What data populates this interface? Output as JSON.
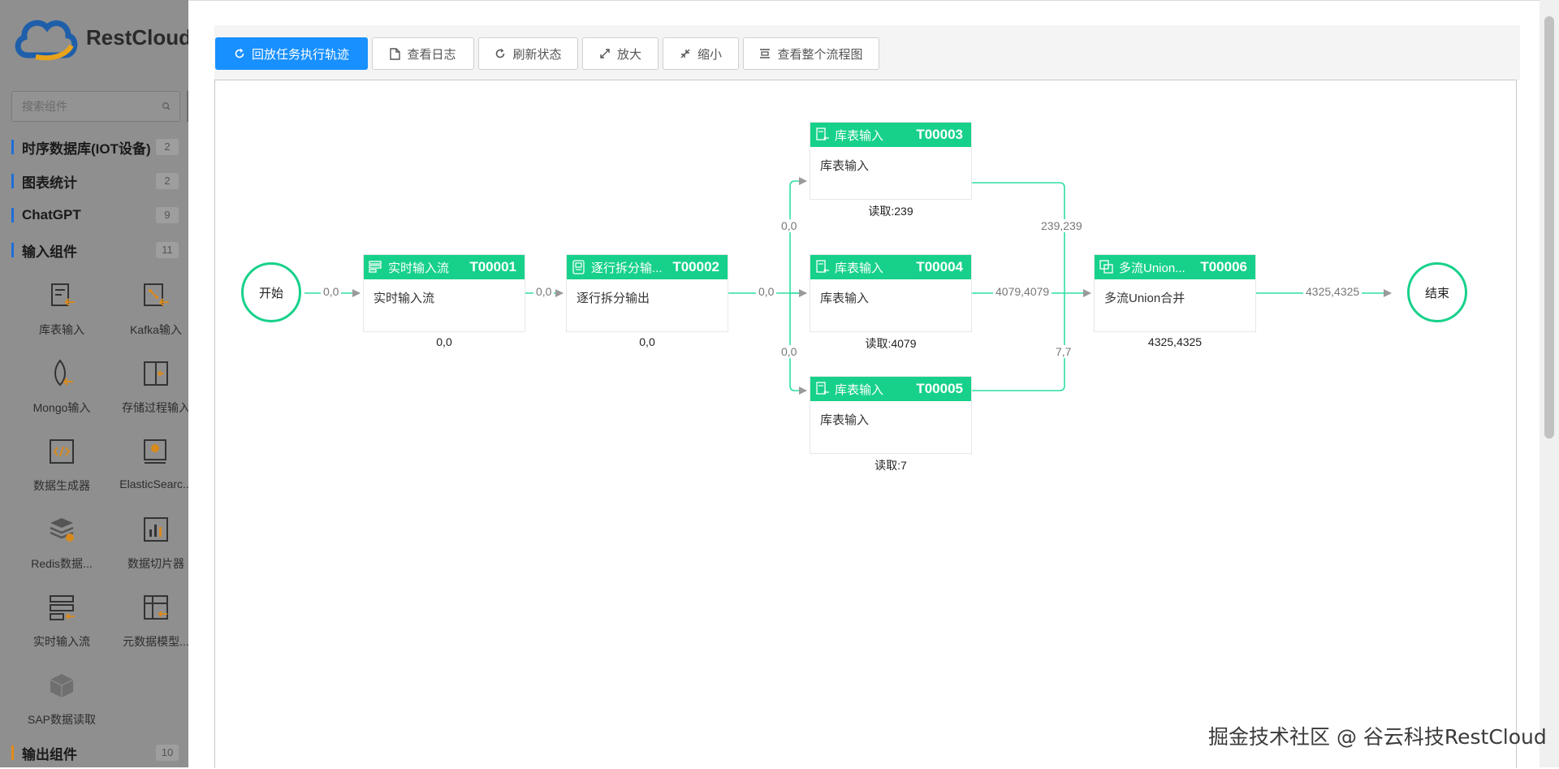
{
  "sidebar": {
    "logo_text": "RestCloud",
    "search_placeholder": "搜索组件",
    "categories": [
      {
        "label": "时序数据库(IOT设备)",
        "count": "2"
      },
      {
        "label": "图表统计",
        "count": "2"
      },
      {
        "label": "ChatGPT",
        "count": "9"
      },
      {
        "label": "输入组件",
        "count": "11"
      },
      {
        "label": "输出组件",
        "count": "10"
      }
    ],
    "components": [
      {
        "label": "库表输入",
        "icon": "table-input-icon"
      },
      {
        "label": "Kafka输入",
        "icon": "kafka-input-icon"
      },
      {
        "label": "Mongo输入",
        "icon": "mongo-input-icon"
      },
      {
        "label": "存储过程输入",
        "icon": "stored-procedure-icon"
      },
      {
        "label": "数据生成器",
        "icon": "code-generator-icon"
      },
      {
        "label": "ElasticSearc...",
        "icon": "elasticsearch-icon"
      },
      {
        "label": "Redis数据...",
        "icon": "redis-icon"
      },
      {
        "label": "数据切片器",
        "icon": "chart-slicer-icon"
      },
      {
        "label": "实时输入流",
        "icon": "stream-input-icon"
      },
      {
        "label": "元数据模型...",
        "icon": "metadata-model-icon"
      },
      {
        "label": "SAP数据读取",
        "icon": "sap-cube-icon"
      }
    ]
  },
  "toolbar": {
    "replay": "回放任务执行轨迹",
    "logs": "查看日志",
    "refresh": "刷新状态",
    "zoom_in": "放大",
    "zoom_out": "缩小",
    "fit": "查看整个流程图"
  },
  "flow": {
    "start": "开始",
    "end": "结束",
    "nodes": [
      {
        "type": "实时输入流",
        "id": "T00001",
        "body": "实时输入流",
        "stat": "0,0"
      },
      {
        "type": "逐行拆分输...",
        "id": "T00002",
        "body": "逐行拆分输出",
        "stat": "0,0"
      },
      {
        "type": "库表输入",
        "id": "T00003",
        "body": "库表输入",
        "stat": "读取:239"
      },
      {
        "type": "库表输入",
        "id": "T00004",
        "body": "库表输入",
        "stat": "读取:4079"
      },
      {
        "type": "库表输入",
        "id": "T00005",
        "body": "库表输入",
        "stat": "读取:7"
      },
      {
        "type": "多流Union...",
        "id": "T00006",
        "body": "多流Union合并",
        "stat": "4325,4325"
      }
    ],
    "edges": [
      "0,0",
      "0,0",
      "0,0",
      "0,0",
      "0,0",
      "239,239",
      "4079,4079",
      "7,7",
      "4325,4325"
    ]
  },
  "watermark": "掘金技术社区 @ 谷云科技RestCloud",
  "colors": {
    "accent": "#1890ff",
    "node": "#17d18a",
    "sidebar": "#8f8f8f"
  }
}
